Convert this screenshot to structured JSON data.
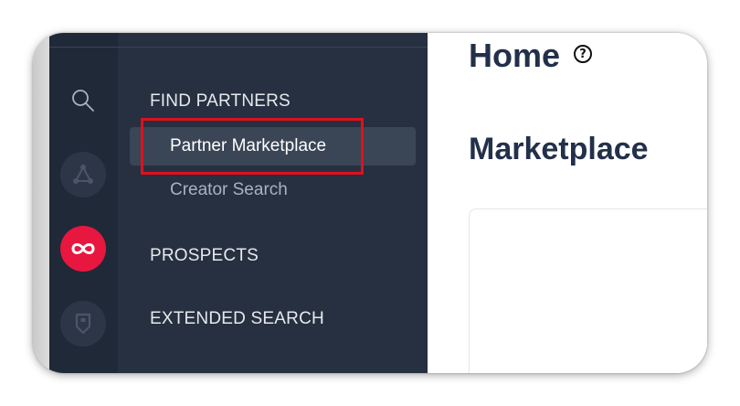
{
  "nav": {
    "find_partners": "FIND PARTNERS",
    "partner_marketplace": "Partner Marketplace",
    "creator_search": "Creator Search",
    "prospects": "PROSPECTS",
    "extended_search": "EXTENDED SEARCH"
  },
  "main": {
    "page_title": "Home",
    "help_glyph": "?",
    "section_title": "Marketplace"
  },
  "rail": {
    "icons": [
      "search-icon",
      "network-icon",
      "infinity-icon",
      "shield-icon"
    ]
  },
  "colors": {
    "rail_bg": "#1f2938",
    "nav_bg": "#263040",
    "active_item_bg": "#3a4556",
    "brand_red": "#e8173f",
    "highlight_border": "#e0101c",
    "heading_text": "#23304a"
  }
}
